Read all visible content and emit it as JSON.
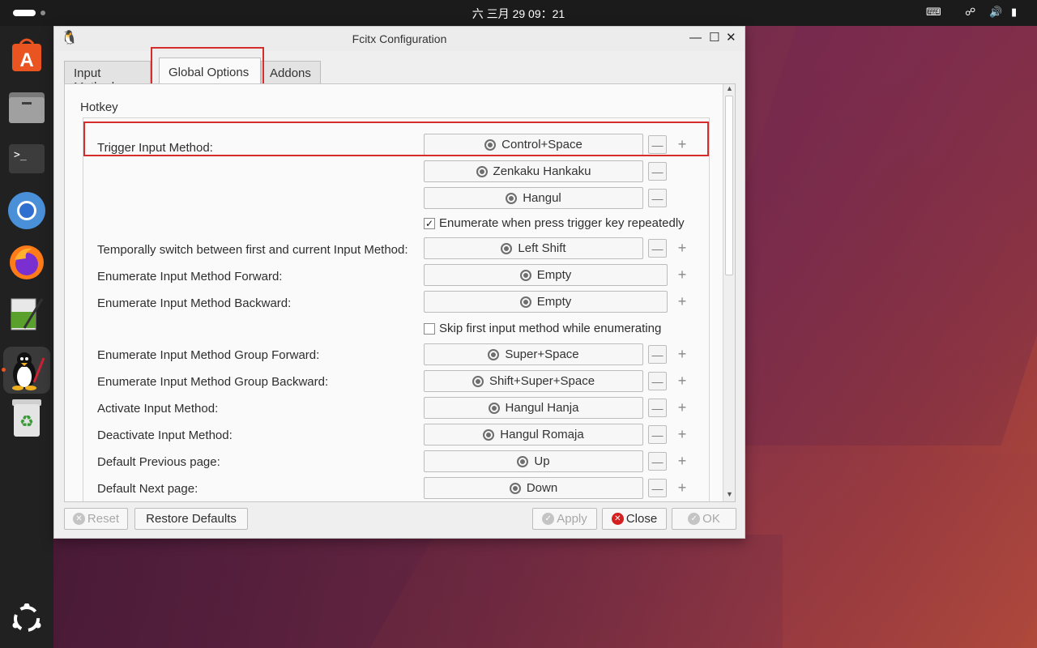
{
  "topbar": {
    "clock": "六 三月 29  09：21"
  },
  "window": {
    "title": "Fcitx Configuration"
  },
  "tabs": [
    {
      "label": "Input Method"
    },
    {
      "label": "Global Options"
    },
    {
      "label": "Addons"
    }
  ],
  "section": {
    "title": "Hotkey"
  },
  "rows": {
    "trigger": {
      "label": "Trigger Input Method:",
      "keys": [
        "Control+Space",
        "Zenkaku Hankaku",
        "Hangul"
      ]
    },
    "enumerate_repeat": {
      "label": "Enumerate when press trigger key repeatedly",
      "checked": true
    },
    "temp_switch": {
      "label": "Temporally switch between first and current Input Method:",
      "key": "Left Shift"
    },
    "enum_forward": {
      "label": "Enumerate Input Method Forward:",
      "key": "Empty"
    },
    "enum_backward": {
      "label": "Enumerate Input Method Backward:",
      "key": "Empty"
    },
    "skip_first": {
      "label": "Skip first input method while enumerating",
      "checked": false
    },
    "group_forward": {
      "label": "Enumerate Input Method Group Forward:",
      "key": "Super+Space"
    },
    "group_backward": {
      "label": "Enumerate Input Method Group Backward:",
      "key": "Shift+Super+Space"
    },
    "activate": {
      "label": "Activate Input Method:",
      "key": "Hangul Hanja"
    },
    "deactivate": {
      "label": "Deactivate Input Method:",
      "key": "Hangul Romaja"
    },
    "prev_page": {
      "label": "Default Previous page:",
      "key": "Up"
    },
    "next_page": {
      "label": "Default Next page:",
      "key": "Down"
    }
  },
  "buttons": {
    "reset": "Reset",
    "restore": "Restore Defaults",
    "apply": "Apply",
    "close": "Close",
    "ok": "OK"
  },
  "colors": {
    "highlight": "#d52c2c",
    "accent": "#e95420",
    "close_icon": "#d62020"
  }
}
